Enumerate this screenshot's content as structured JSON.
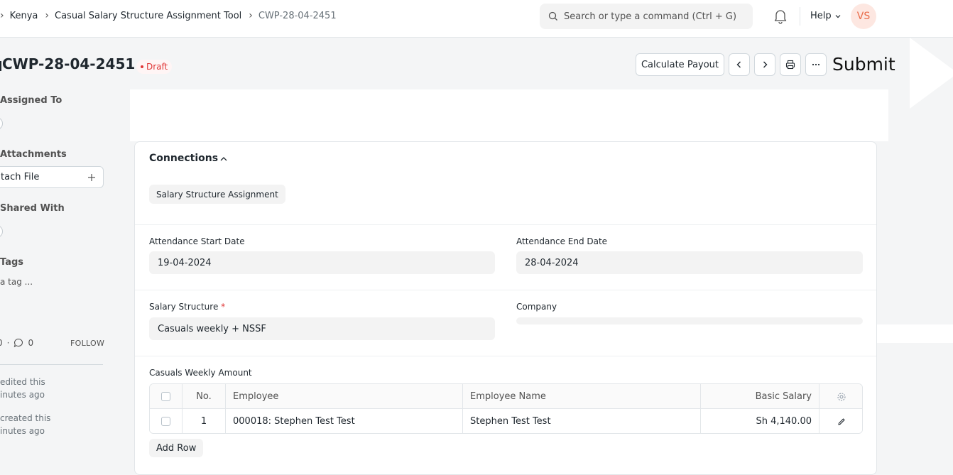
{
  "breadcrumb": {
    "items": [
      "Kenya",
      "Casual Salary Structure Assignment Tool",
      "CWP-28-04-2451"
    ]
  },
  "navbar": {
    "search_placeholder": "Search or type a command (Ctrl + G)",
    "help_label": "Help",
    "avatar_initials": "VS"
  },
  "page": {
    "title": "CWP-28-04-2451",
    "status": "Draft",
    "status_color": "#e03636",
    "actions": {
      "calculate_payout": "Calculate Payout",
      "submit": "Submit"
    }
  },
  "sidebar": {
    "assigned_to_label": "Assigned To",
    "attachments_label": "Attachments",
    "attach_file_label": "tach File",
    "shared_with_label": "Shared With",
    "tags_label": "Tags",
    "add_tag_label": "a tag ...",
    "likes_count": "0",
    "comments_count": "0",
    "follow_label": "FOLLOW",
    "activity": [
      {
        "line1": "edited this",
        "line2": "inutes ago"
      },
      {
        "line1": "created this",
        "line2": "inutes ago"
      }
    ]
  },
  "connections": {
    "title": "Connections",
    "items": [
      "Salary Structure Assignment"
    ]
  },
  "form": {
    "attendance_start_date": {
      "label": "Attendance Start Date",
      "value": "19-04-2024"
    },
    "attendance_end_date": {
      "label": "Attendance End Date",
      "value": "28-04-2024"
    },
    "salary_structure": {
      "label": "Salary Structure",
      "required_mark": "*",
      "value": "Casuals weekly + NSSF"
    },
    "company": {
      "label": "Company",
      "value": ""
    }
  },
  "table": {
    "label": "Casuals Weekly Amount",
    "columns": [
      "No.",
      "Employee",
      "Employee Name",
      "Basic Salary"
    ],
    "rows": [
      {
        "no": "1",
        "employee": "000018: Stephen Test Test",
        "employee_name": "Stephen Test Test",
        "basic_salary": "Sh 4,140.00"
      }
    ],
    "add_row_label": "Add Row"
  }
}
